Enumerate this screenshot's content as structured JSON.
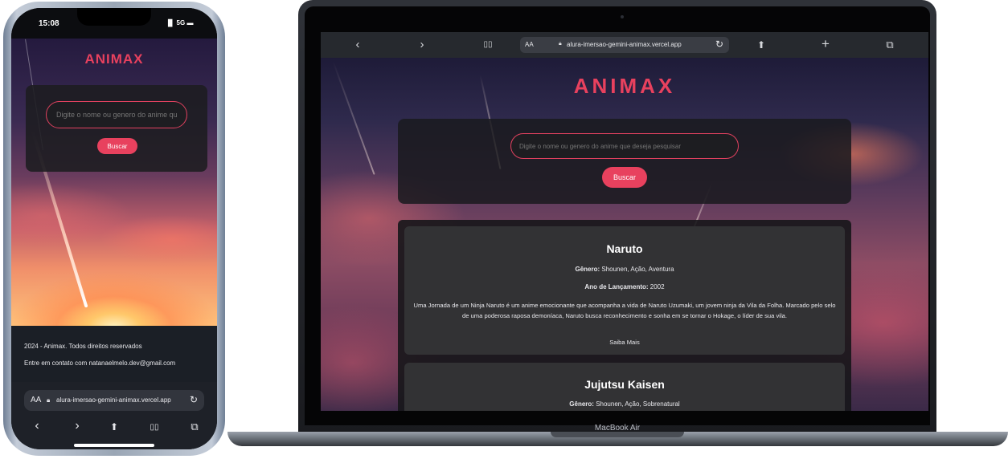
{
  "phone": {
    "status": {
      "time": "15:08",
      "signal": "▐▌ 5G ▬"
    },
    "logo": "ANIMAX",
    "search": {
      "placeholder": "Digite o nome ou genero do anime que deseja pesquisar",
      "button": "Buscar"
    },
    "footer": {
      "copyright": "2024 - Animax. Todos direitos reservados",
      "contact": "Entre em contato com natanaelmelo.dev@gmail.com"
    },
    "browser": {
      "aa": "AA",
      "url": "alura-imersao-gemini-animax.vercel.app",
      "icons": {
        "reload": "↻",
        "back": "‹",
        "forward": "›",
        "share": "⬆",
        "bookmarks": "▯▯",
        "tabs": "⧉"
      }
    }
  },
  "laptop": {
    "label": "MacBook Air",
    "browser": {
      "aa": "AA",
      "url": "alura-imersao-gemini-animax.vercel.app",
      "icons": {
        "back": "‹",
        "forward": "›",
        "bookmarks": "▯▯",
        "reload": "↻",
        "share": "⬆",
        "new_tab": "+",
        "tabs": "⧉"
      }
    },
    "site": {
      "logo": "ANIMAX",
      "search": {
        "placeholder": "Digite o nome ou genero do anime que deseja pesquisar",
        "button": "Buscar"
      },
      "results": [
        {
          "title": "Naruto",
          "genre_label": "Gênero:",
          "genre": "Shounen, Ação, Aventura",
          "year_label": "Ano de Lançamento:",
          "year": "2002",
          "synopsis": "Uma Jornada de um Ninja Naruto é um anime emocionante que acompanha a vida de Naruto Uzumaki, um jovem ninja da Vila da Folha. Marcado pelo selo de uma poderosa raposa demoníaca, Naruto busca reconhecimento e sonha em se tornar o Hokage, o líder de sua vila.",
          "link": "Saiba Mais"
        },
        {
          "title": "Jujutsu Kaisen",
          "genre_label": "Gênero:",
          "genre": "Shounen, Ação, Sobrenatural"
        }
      ]
    }
  },
  "colors": {
    "accent": "#e8415e",
    "card": "#323234",
    "panel": "#1a1a1e",
    "footer": "#1b1f26"
  }
}
